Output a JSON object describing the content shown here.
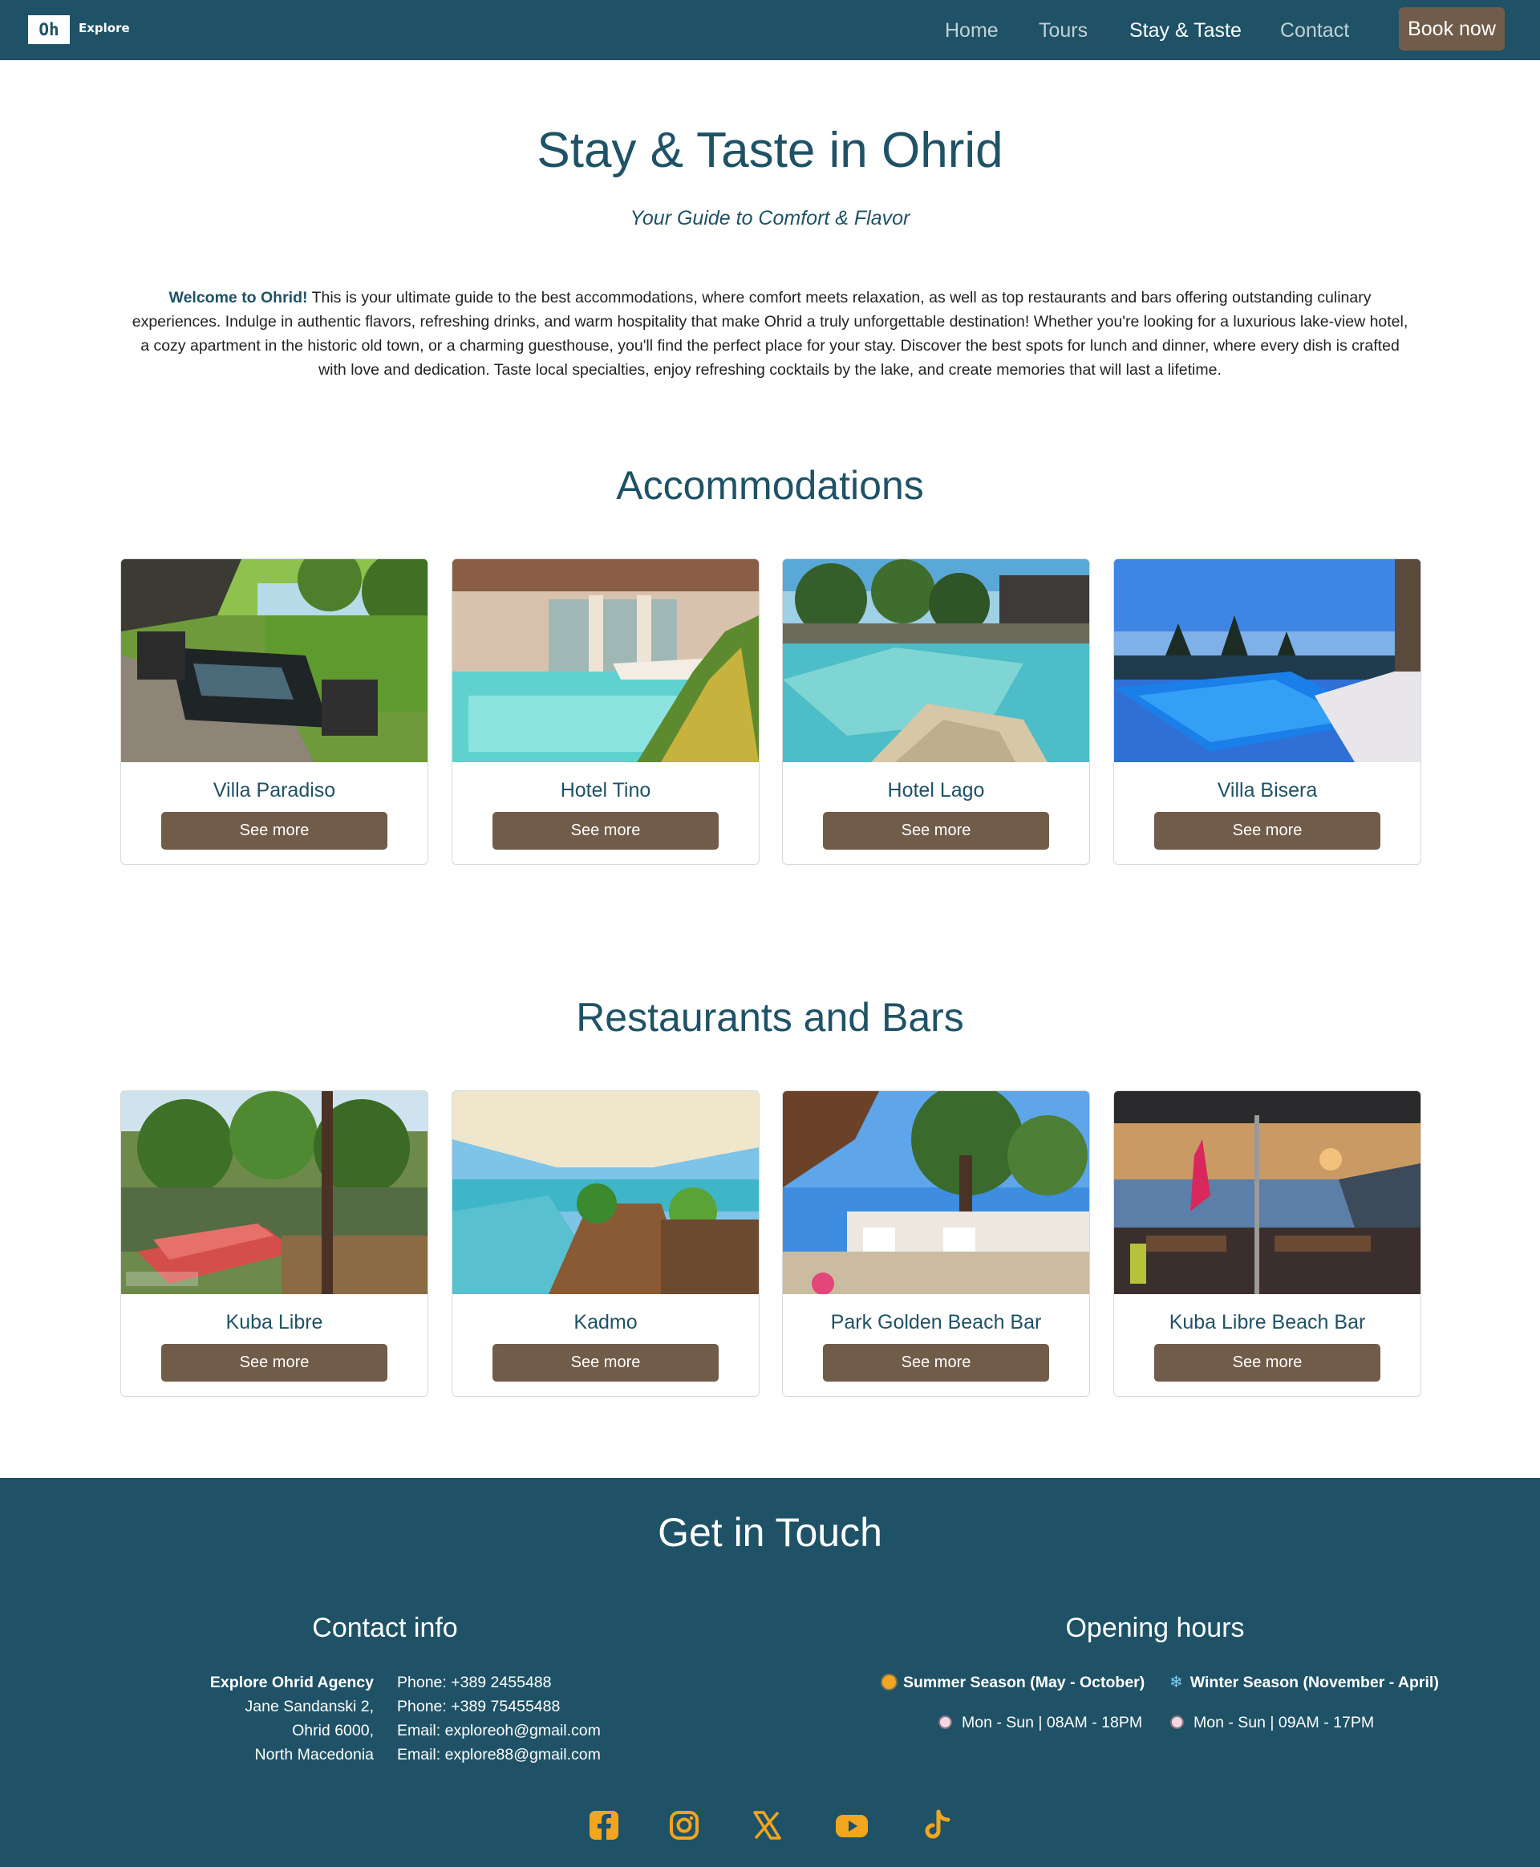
{
  "nav": {
    "logo_mark": "Oh",
    "logo_text": "Explore",
    "links": [
      "Home",
      "Tours",
      "Stay & Taste",
      "Contact"
    ],
    "active": "Stay & Taste",
    "book_label": "Book now"
  },
  "hero": {
    "title": "Stay & Taste in Ohrid",
    "subtitle": "Your Guide to Comfort & Flavor",
    "intro_lead": "Welcome to Ohrid!",
    "intro_body": " This is your ultimate guide to the best accommodations, where comfort meets relaxation, as well as top restaurants and bars offering outstanding culinary experiences. Indulge in authentic flavors, refreshing drinks, and warm hospitality that make Ohrid a truly unforgettable destination! Whether you're looking for a luxurious lake-view hotel, a cozy apartment in the historic old town, or a charming guesthouse, you'll find the perfect place for your stay. Discover the best spots for lunch and dinner, where every dish is crafted with love and dedication. Taste local specialties, enjoy refreshing cocktails by the lake, and create memories that will last a lifetime."
  },
  "accommodations": {
    "title": "Accommodations",
    "items": [
      {
        "name": "Villa Paradiso",
        "button": "See more"
      },
      {
        "name": "Hotel Tino",
        "button": "See more"
      },
      {
        "name": "Hotel Lago",
        "button": "See more"
      },
      {
        "name": "Villa Bisera",
        "button": "See more"
      }
    ]
  },
  "restaurants": {
    "title": "Restaurants and Bars",
    "items": [
      {
        "name": "Kuba Libre",
        "button": "See more"
      },
      {
        "name": "Kadmo",
        "button": "See more"
      },
      {
        "name": "Park Golden Beach Bar",
        "button": "See more"
      },
      {
        "name": "Kuba Libre Beach Bar",
        "button": "See more"
      }
    ]
  },
  "footer": {
    "title": "Get in Touch",
    "contact": {
      "heading": "Contact info",
      "address": [
        "Explore Ohrid Agency",
        "Jane Sandanski 2,",
        "Ohrid 6000,",
        "North Macedonia"
      ],
      "lines": [
        "Phone: +389 2455488",
        "Phone: +389 75455488",
        "Email: exploreoh@gmail.com",
        "Email: explore88@gmail.com"
      ]
    },
    "hours": {
      "heading": "Opening hours",
      "summer_label": "Summer Season (May - October)",
      "summer_hours": "Mon - Sun | 08AM - 18PM",
      "winter_label": "Winter Season (November - April)",
      "winter_hours": "Mon - Sun | 09AM - 17PM"
    },
    "social": [
      "facebook-icon",
      "instagram-icon",
      "x-icon",
      "youtube-icon",
      "tiktok-icon"
    ],
    "icon_color": "#f2a51f"
  },
  "colors": {
    "primary": "#1f5266",
    "accent_brown": "#715c4a",
    "social": "#f2a51f"
  }
}
